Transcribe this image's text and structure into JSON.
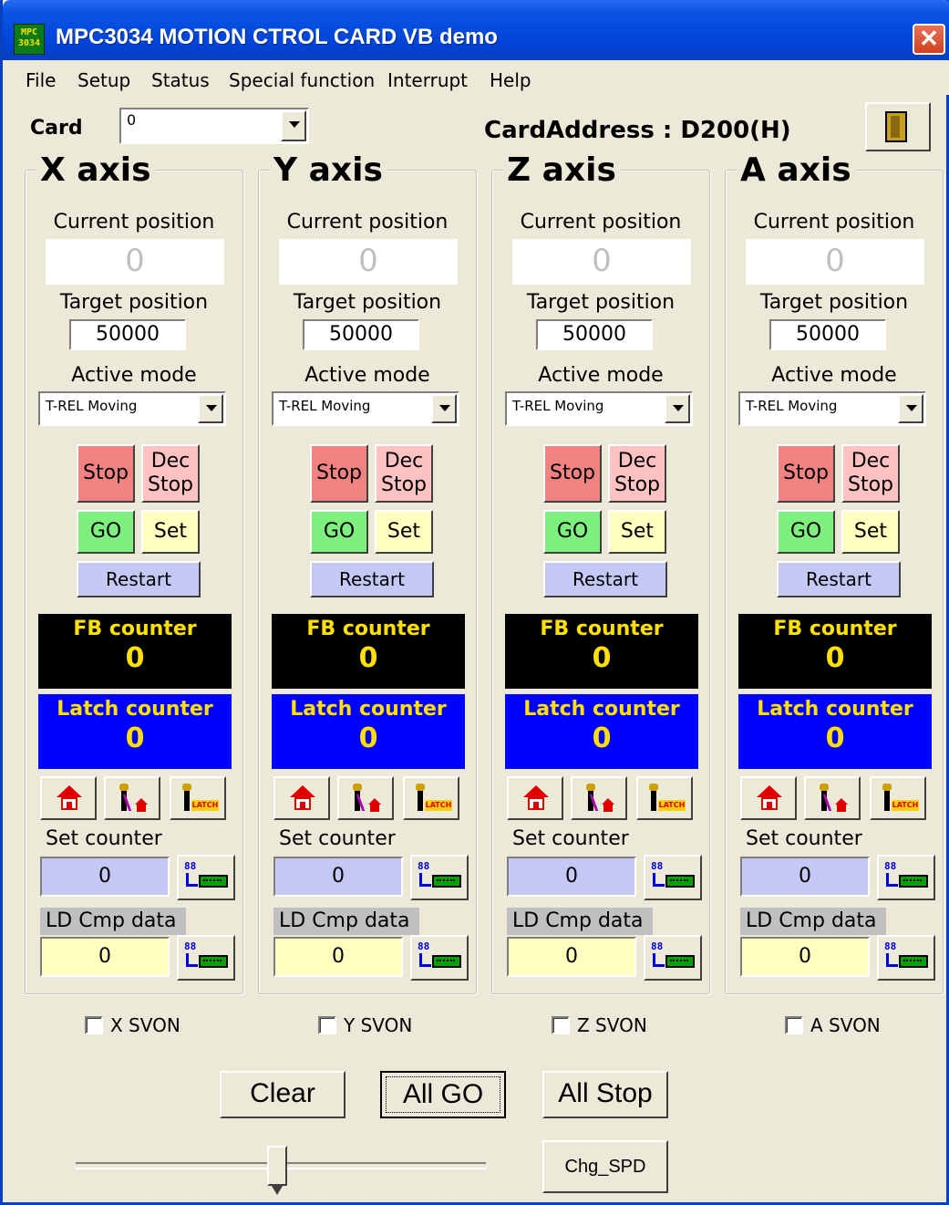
{
  "window": {
    "title": "MPC3034 MOTION CTROL CARD  VB demo",
    "icon_text": "MPC 3034",
    "close_symbol": "✕"
  },
  "menu": [
    "File",
    "Setup",
    "Status",
    "Special function",
    "Interrupt",
    "Help"
  ],
  "card": {
    "label": "Card",
    "selected": "0",
    "address_text": "CardAddress : D200(H)"
  },
  "axes": [
    {
      "title": "X axis",
      "current_label": "Current position",
      "current_value": "0",
      "target_label": "Target position",
      "target_value": "50000",
      "mode_label": "Active mode",
      "mode_value": "T-REL Moving",
      "stop": "Stop",
      "dec_stop_1": "Dec",
      "dec_stop_2": "Stop",
      "go": "GO",
      "set": "Set",
      "restart": "Restart",
      "fb_label": "FB counter",
      "fb_value": "0",
      "latch_label": "Latch counter",
      "latch_value": "0",
      "latch_icon_text": "LATCH",
      "set_counter_label": "Set  counter",
      "set_counter_value": "0",
      "ld_label": "LD Cmp data",
      "ld_value": "0",
      "write_icon_num": "88",
      "svon_label": "X SVON"
    },
    {
      "title": "Y axis",
      "current_label": "Current position",
      "current_value": "0",
      "target_label": "Target position",
      "target_value": "50000",
      "mode_label": "Active mode",
      "mode_value": "T-REL Moving",
      "stop": "Stop",
      "dec_stop_1": "Dec",
      "dec_stop_2": "Stop",
      "go": "GO",
      "set": "Set",
      "restart": "Restart",
      "fb_label": "FB counter",
      "fb_value": "0",
      "latch_label": "Latch counter",
      "latch_value": "0",
      "latch_icon_text": "LATCH",
      "set_counter_label": "Set  counter",
      "set_counter_value": "0",
      "ld_label": "LD Cmp data",
      "ld_value": "0",
      "write_icon_num": "88",
      "svon_label": "Y SVON"
    },
    {
      "title": "Z axis",
      "current_label": "Current position",
      "current_value": "0",
      "target_label": "Target position",
      "target_value": "50000",
      "mode_label": "Active mode",
      "mode_value": "T-REL Moving",
      "stop": "Stop",
      "dec_stop_1": "Dec",
      "dec_stop_2": "Stop",
      "go": "GO",
      "set": "Set",
      "restart": "Restart",
      "fb_label": "FB counter",
      "fb_value": "0",
      "latch_label": "Latch counter",
      "latch_value": "0",
      "latch_icon_text": "LATCH",
      "set_counter_label": "Set  counter",
      "set_counter_value": "0",
      "ld_label": "LD Cmp data",
      "ld_value": "0",
      "write_icon_num": "88",
      "svon_label": "Z SVON"
    },
    {
      "title": "A axis",
      "current_label": "Current position",
      "current_value": "0",
      "target_label": "Target position",
      "target_value": "50000",
      "mode_label": "Active mode",
      "mode_value": "T-REL Moving",
      "stop": "Stop",
      "dec_stop_1": "Dec",
      "dec_stop_2": "Stop",
      "go": "GO",
      "set": "Set",
      "restart": "Restart",
      "fb_label": "FB counter",
      "fb_value": "0",
      "latch_label": "Latch counter",
      "latch_value": "0",
      "latch_icon_text": "LATCH",
      "set_counter_label": "Set  counter",
      "set_counter_value": "0",
      "ld_label": "LD Cmp data",
      "ld_value": "0",
      "write_icon_num": "88",
      "svon_label": "A SVON"
    }
  ],
  "bottom": {
    "clear": "Clear",
    "all_go": "All GO",
    "all_stop": "All Stop",
    "chg_spd": "Chg_SPD",
    "speed_slider_level": 0.49
  },
  "colors": {
    "stop": "#f28282",
    "dec_stop": "#ffc2c2",
    "go": "#7ef07e",
    "set": "#ffffc0",
    "restart": "#c4c8f4",
    "fb_bg": "#000000",
    "latch_bg": "#0000ff",
    "counter_text": "#ffe000"
  }
}
